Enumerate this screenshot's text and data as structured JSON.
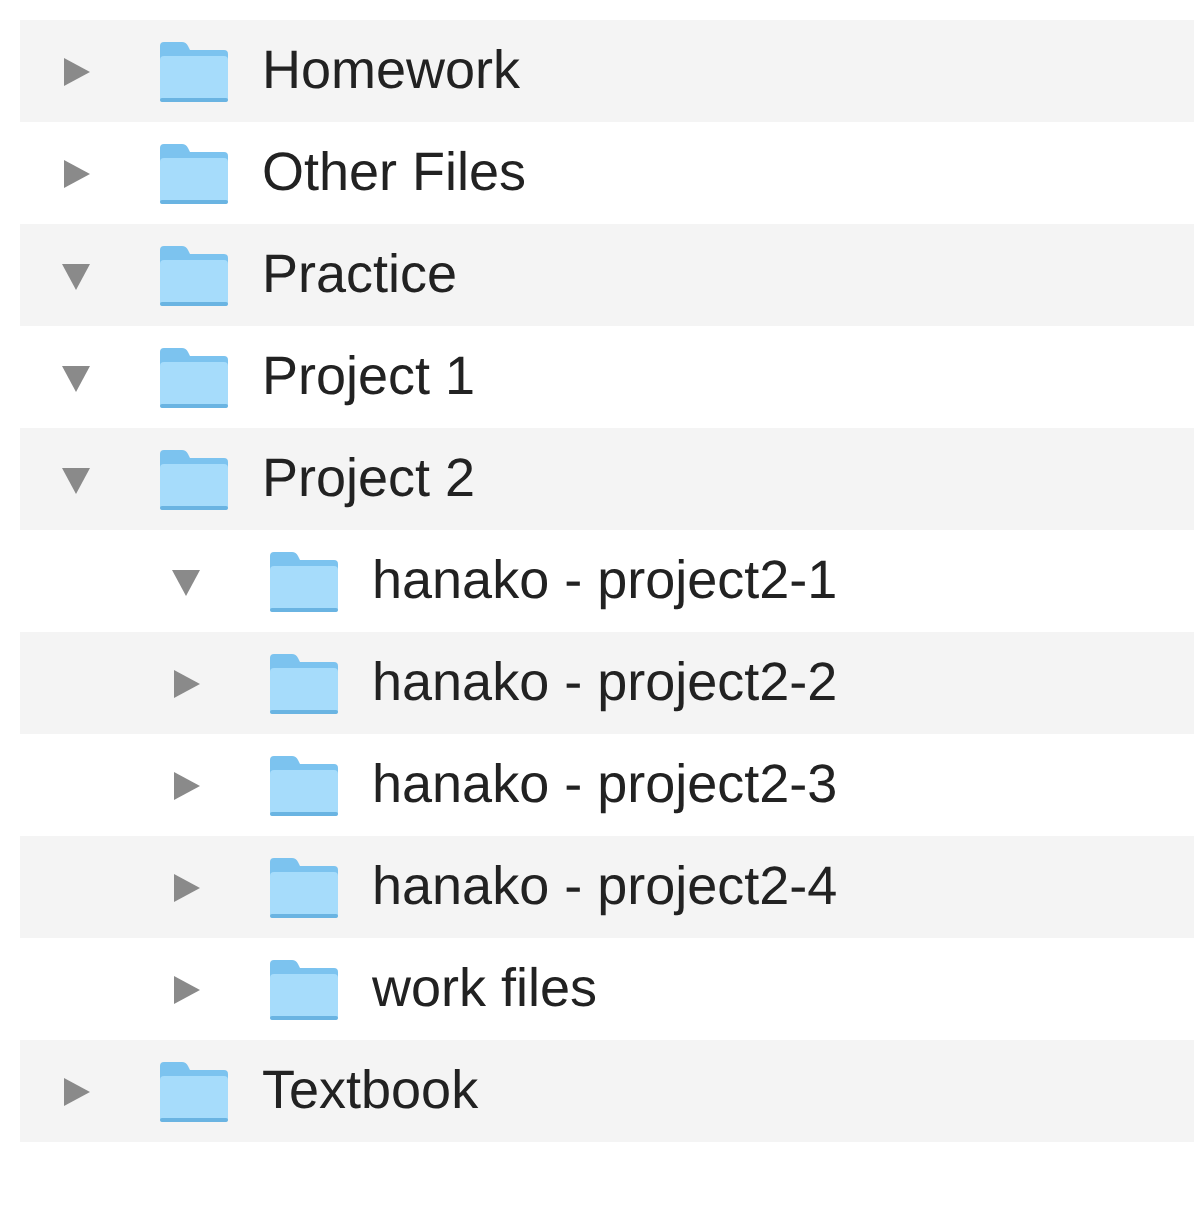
{
  "tree": [
    {
      "name": "Homework",
      "expanded": false
    },
    {
      "name": "Other Files",
      "expanded": false
    },
    {
      "name": "Practice",
      "expanded": true
    },
    {
      "name": "Project 1",
      "expanded": true
    },
    {
      "name": "Project 2",
      "expanded": true,
      "children": [
        {
          "name": "hanako - project2-1",
          "expanded": true
        },
        {
          "name": "hanako - project2-2",
          "expanded": false
        },
        {
          "name": "hanako - project2-3",
          "expanded": false
        },
        {
          "name": "hanako - project2-4",
          "expanded": false
        },
        {
          "name": "work files",
          "expanded": false
        }
      ]
    },
    {
      "name": "Textbook",
      "expanded": false
    }
  ]
}
